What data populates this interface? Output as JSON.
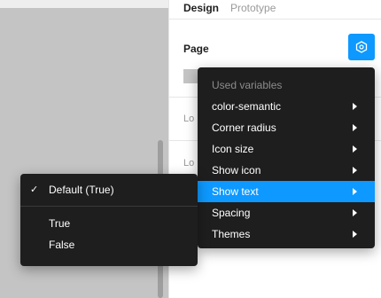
{
  "tabs": {
    "design": "Design",
    "prototype": "Prototype"
  },
  "page": {
    "title": "Page"
  },
  "panel_rows": [
    "Lo",
    "Lo"
  ],
  "menu": {
    "header": "Used variables",
    "items": [
      {
        "label": "color-semantic",
        "has_submenu": true,
        "active": false
      },
      {
        "label": "Corner radius",
        "has_submenu": true,
        "active": false
      },
      {
        "label": "Icon size",
        "has_submenu": true,
        "active": false
      },
      {
        "label": "Show icon",
        "has_submenu": true,
        "active": false
      },
      {
        "label": "Show text",
        "has_submenu": true,
        "active": true
      },
      {
        "label": "Spacing",
        "has_submenu": true,
        "active": false
      },
      {
        "label": "Themes",
        "has_submenu": true,
        "active": false
      }
    ]
  },
  "submenu": {
    "default_option": "Default (True)",
    "options": [
      "True",
      "False"
    ]
  },
  "icons": {
    "variables": "variables-hexagon-icon",
    "check": "checkmark-icon",
    "submenu_arrow": "chevron-right-icon"
  },
  "colors": {
    "accent": "#0d99ff",
    "menu_bg": "#1e1e1e",
    "canvas": "#c4c4c4"
  }
}
